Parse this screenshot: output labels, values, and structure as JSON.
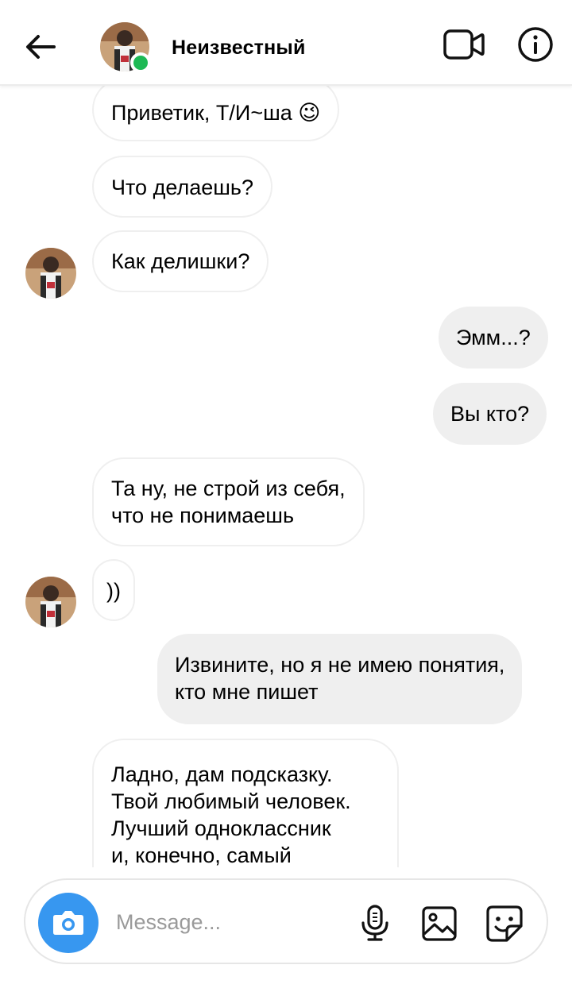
{
  "header": {
    "contact_name": "Неизвестный",
    "online_color": "#1db954"
  },
  "messages": [
    {
      "dir": "in",
      "text": "Приветик, Т/И~ша 😉"
    },
    {
      "dir": "in",
      "text": "Что делаешь?"
    },
    {
      "dir": "in",
      "text": "Как делишки?",
      "avatar": true
    },
    {
      "dir": "out",
      "text": "Эмм...?"
    },
    {
      "dir": "out",
      "text": "Вы кто?"
    },
    {
      "dir": "in",
      "lines": [
        "Та ну, не строй из себя,",
        "что не понимаешь"
      ]
    },
    {
      "dir": "in",
      "text": "))",
      "avatar": true
    },
    {
      "dir": "out",
      "lines": [
        "Извините, но я не имею понятия,",
        "кто мне пишет"
      ]
    },
    {
      "dir": "in",
      "lines": [
        "Ладно, дам подсказку.",
        "Твой любимый человек.",
        "Лучший одноклассник",
        "и, конечно, самый"
      ]
    }
  ],
  "composer": {
    "placeholder": "Message...",
    "camera_color": "#3797f0"
  },
  "icons": [
    "back-arrow-icon",
    "video-call-icon",
    "info-icon",
    "camera-icon",
    "microphone-icon",
    "gallery-icon",
    "sticker-icon"
  ]
}
